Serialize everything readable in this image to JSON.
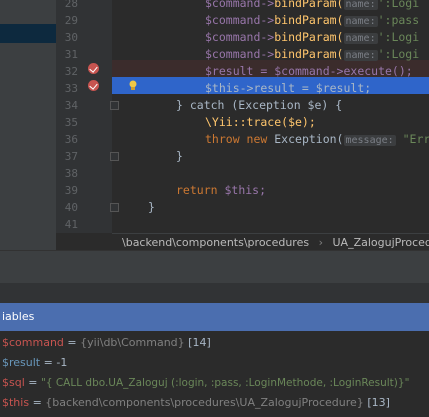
{
  "editor": {
    "lines": [
      {
        "num": "28",
        "pre": "$command->",
        "fn": "bindParam(",
        "hint": "name:",
        "tail": "':Logi"
      },
      {
        "num": "29",
        "pre": "$command->",
        "fn": "bindParam(",
        "hint": "name:",
        "tail": "':pass"
      },
      {
        "num": "30",
        "pre": "$command->",
        "fn": "bindParam(",
        "hint": "name:",
        "tail": "':Logi"
      },
      {
        "num": "31",
        "pre": "$command->",
        "fn": "bindParam(",
        "hint": "name:",
        "tail": "':Logi"
      },
      {
        "num": "32",
        "text": "$result = $command->execute();"
      },
      {
        "num": "33",
        "text": "$this->result = $result;"
      },
      {
        "num": "34",
        "text": "} catch (Exception $e) {"
      },
      {
        "num": "35",
        "text": "\\Yii::trace($e);"
      },
      {
        "num": "36",
        "kw": "throw new",
        "cls": "Exception(",
        "hint": "message:",
        "tail": "\"Err"
      },
      {
        "num": "37",
        "text": "}"
      },
      {
        "num": "38",
        "text": ""
      },
      {
        "num": "39",
        "kw": "return",
        "tail": "$this;"
      },
      {
        "num": "40",
        "text": "}"
      },
      {
        "num": "41",
        "text": ""
      }
    ],
    "breadcrumb": {
      "path": "\\backend\\components\\procedures",
      "arrow": "›",
      "class": "UA_ZalogujProcedure"
    }
  },
  "variables_panel": {
    "title": "iables",
    "rows": [
      {
        "name": "$command",
        "eq": "=",
        "value": "{yii\\db\\Command}",
        "extra": "[14]"
      },
      {
        "name": "$result",
        "eq": "=",
        "value": "-1",
        "extra": ""
      },
      {
        "name": "$sql",
        "eq": "=",
        "value": "\"{ CALL dbo.UA_Zaloguj (:login, :pass, :LoginMethode, :LoginResult)}\"",
        "extra": ""
      },
      {
        "name": "$this",
        "eq": "=",
        "value": "{backend\\components\\procedures\\UA_ZalogujProcedure}",
        "extra": "[13]"
      }
    ]
  },
  "colors": {
    "editor_bg": "#2b2b2b",
    "current_line": "#2f65ca",
    "breakpoint": "#c75450",
    "panel_header": "#4b6eaf"
  }
}
